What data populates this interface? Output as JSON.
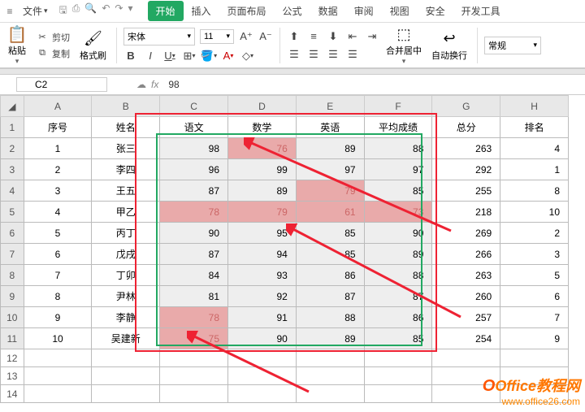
{
  "menubar": {
    "file_label": "文件",
    "tabs": [
      "开始",
      "插入",
      "页面布局",
      "公式",
      "数据",
      "审阅",
      "视图",
      "安全",
      "开发工具"
    ]
  },
  "ribbon": {
    "paste": "粘贴",
    "cut": "剪切",
    "copy": "复制",
    "fmt_painter": "格式刷",
    "font": "宋体",
    "size": "11",
    "merge_center": "合并居中",
    "wrap": "自动换行",
    "style_group": "常规"
  },
  "fbar": {
    "cell": "C2",
    "formula": "98"
  },
  "columns": [
    "A",
    "B",
    "C",
    "D",
    "E",
    "F",
    "G",
    "H"
  ],
  "headers": {
    "A": "序号",
    "B": "姓名",
    "C": "语文",
    "D": "数学",
    "E": "英语",
    "F": "平均成绩",
    "G": "总分",
    "H": "排名"
  },
  "rows": [
    {
      "n": "1",
      "name": "张三",
      "c": "98",
      "d": "76",
      "e": "89",
      "f": "88",
      "g": "263",
      "h": "4",
      "red": [
        "d"
      ]
    },
    {
      "n": "2",
      "name": "李四",
      "c": "96",
      "d": "99",
      "e": "97",
      "f": "97",
      "g": "292",
      "h": "1",
      "red": []
    },
    {
      "n": "3",
      "name": "王五",
      "c": "87",
      "d": "89",
      "e": "79",
      "f": "85",
      "g": "255",
      "h": "8",
      "red": [
        "e"
      ]
    },
    {
      "n": "4",
      "name": "甲乙",
      "c": "78",
      "d": "79",
      "e": "61",
      "f": "73",
      "g": "218",
      "h": "10",
      "red": [
        "c",
        "d",
        "e",
        "f"
      ]
    },
    {
      "n": "5",
      "name": "丙丁",
      "c": "90",
      "d": "95",
      "e": "85",
      "f": "90",
      "g": "269",
      "h": "2",
      "red": []
    },
    {
      "n": "6",
      "name": "戊戌",
      "c": "87",
      "d": "94",
      "e": "85",
      "f": "89",
      "g": "266",
      "h": "3",
      "red": []
    },
    {
      "n": "7",
      "name": "丁卯",
      "c": "84",
      "d": "93",
      "e": "86",
      "f": "88",
      "g": "263",
      "h": "5",
      "red": []
    },
    {
      "n": "8",
      "name": "尹林",
      "c": "81",
      "d": "92",
      "e": "87",
      "f": "87",
      "g": "260",
      "h": "6",
      "red": []
    },
    {
      "n": "9",
      "name": "李静",
      "c": "78",
      "d": "91",
      "e": "88",
      "f": "86",
      "g": "257",
      "h": "7",
      "red": [
        "c"
      ]
    },
    {
      "n": "10",
      "name": "吴建新",
      "c": "75",
      "d": "90",
      "e": "89",
      "f": "85",
      "g": "254",
      "h": "9",
      "red": [
        "c"
      ]
    }
  ],
  "watermark": {
    "line1": "Office教程网",
    "line2": "www.office26.com"
  }
}
